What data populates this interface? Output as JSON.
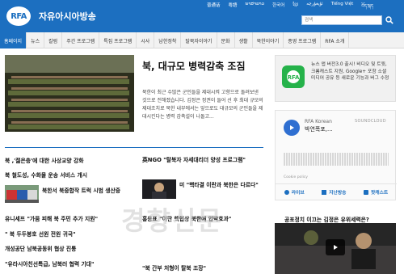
{
  "header": {
    "logo": "RFA",
    "site_name": "자유아시아방송",
    "languages": [
      "普通话",
      "粤語",
      "ພາສາລາວ",
      "한국어",
      "ខ្មែរ",
      "ئۇيغۇرچە",
      "Tiếng Việt",
      "བོད་སྐད"
    ],
    "search_placeholder": "검색",
    "accent": "#1c6fc0"
  },
  "nav": {
    "items": [
      "홈페이지",
      "뉴스",
      "칼럼",
      "주간 프로그램",
      "특집 프로그램",
      "시사",
      "남한정착",
      "탈북자이야기",
      "문화",
      "생활",
      "북한이야기",
      "종영 프로그램",
      "RFA 소개"
    ]
  },
  "lead": {
    "title": "북, 대규모 병력감축 조짐",
    "summary": "북한이 최근 수많은 군인들을 제대시켜 고향으로 돌려보낸 것으로 전해졌습니다. 김정은 정권이 들어 선 후 최대 규모의 제대조치로 북한 내부에서는 앞으로도 대규모의 군인들을 제대시킨다는 병력 감축설이 나돌고..."
  },
  "left_list": {
    "items": [
      "북 ,'젊은층'에 대한 사상교양 강화",
      "북 철도성, 수화물 운송 서비스 개시",
      "북한서 북중합작 트럭 시범 생산중",
      "유니세프 \"가뭄 피해 북 주민 추가 지원\"",
      "\" 북 두두봉호 선원 전원 귀국\"",
      "개성공단 남북공동위 협상 진통",
      "\"유라시아친선특급, 남북러 협력 기대\""
    ]
  },
  "mid_list": {
    "top_item": "英NGO \"탈북자 자세대리더 양성 프로그램\"",
    "item_with_thumb": "미 \"핵타결 이란과 북한은 다르다\"",
    "items": [
      "홍용표 \"이란 핵협상 북한에 압박효과\"",
      "\"북 간부 처형이 탈북 조장\""
    ]
  },
  "sidebar": {
    "app_text": "뉴스 앱 버전3.0 출시! 비디오 및 트윗, 크롬캐스트 지원, Google+ 포함 소셜 미디어 공유 등 새로운 기능과 버그 수정",
    "soundcloud": {
      "account": "RFA Korean",
      "track": "박연폭포,...",
      "brand": "SOUNDCLOUD",
      "policy": "Cookie policy",
      "tabs": [
        "라이브",
        "지난방송",
        "팟캐스트"
      ]
    },
    "video_caption": "공포정치 이끄는 김정은 유위세력은?"
  },
  "watermark": "경향신문"
}
